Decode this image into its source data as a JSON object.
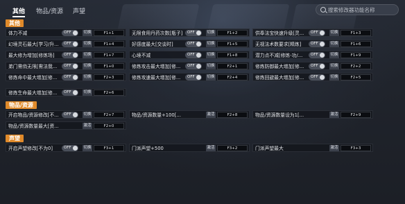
{
  "tabs": [
    {
      "label": "其他"
    },
    {
      "label": "物品/资源"
    },
    {
      "label": "声望"
    }
  ],
  "search": {
    "placeholder": "搜索修改器功能名称"
  },
  "sections": [
    {
      "title": "其他"
    },
    {
      "title": "物品/资源"
    },
    {
      "title": "声望"
    }
  ],
  "rows": [
    {
      "label": "体力不减",
      "toggle": "OFF",
      "action": "切换",
      "hotkey": "F1+1"
    },
    {
      "label": "无限食用丹药次数[瓶子]",
      "toggle": "OFF",
      "action": "切换",
      "hotkey": "F1+2"
    },
    {
      "label": "供奉法宝快速升级[灵...",
      "toggle": "OFF",
      "action": "切换",
      "hotkey": "F1+3"
    },
    {
      "label": "幻境灵石最大[学习/升...",
      "toggle": "OFF",
      "action": "切换",
      "hotkey": "F1+4"
    },
    {
      "label": "好感度最大[交谈时]",
      "toggle": "OFF",
      "action": "切换",
      "hotkey": "F1+5"
    },
    {
      "label": "无视法术数要求[精炼]",
      "toggle": "OFF",
      "action": "切换",
      "hotkey": "F1+6"
    },
    {
      "label": "最大修为增加[修炼场]",
      "toggle": "OFF",
      "action": "切换",
      "hotkey": "F1+7"
    },
    {
      "label": "心境不减",
      "toggle": "OFF",
      "action": "切换",
      "hotkey": "F1+8"
    },
    {
      "label": "潜力点不减[修炼-功/...",
      "toggle": "OFF",
      "action": "切换",
      "hotkey": "F1+9"
    },
    {
      "label": "弟门需俏无限[需法我...",
      "toggle": "OFF",
      "action": "切换",
      "hotkey": "F1+0"
    },
    {
      "label": "修炼攻击最大增加[修...",
      "toggle": "OFF",
      "action": "切换",
      "hotkey": "F2+1"
    },
    {
      "label": "修炼防御最大增加[修...",
      "toggle": "OFF",
      "action": "切换",
      "hotkey": "F2+2"
    },
    {
      "label": "修炼命中最大增加[修...",
      "toggle": "OFF",
      "action": "切换",
      "hotkey": "F2+3"
    },
    {
      "label": "修炼攻速最大增加[修...",
      "toggle": "OFF",
      "action": "切换",
      "hotkey": "F2+4"
    },
    {
      "label": "修炼回避最大增加[修...",
      "toggle": "OFF",
      "action": "切换",
      "hotkey": "F2+5"
    },
    {
      "label": "修炼生命最大增加[修...",
      "toggle": "OFF",
      "action": "切换",
      "hotkey": "F2+6"
    },
    {
      "label": "开启物品/资源修改[不...",
      "toggle": "OFF",
      "action": "切换",
      "hotkey": "F2+7"
    },
    {
      "label": "物品/资源数量+100[...",
      "toggle": "",
      "action": "激活",
      "hotkey": "F2+8"
    },
    {
      "label": "物品/资源数量设为1[...",
      "toggle": "",
      "action": "激活",
      "hotkey": "F2+9"
    },
    {
      "label": "物品/资源数量最大[资...",
      "toggle": "",
      "action": "激活",
      "hotkey": "F2+0"
    },
    {
      "label": "开启声望修改[不为0]",
      "toggle": "OFF",
      "action": "切换",
      "hotkey": "F3+1"
    },
    {
      "label": "门派声望+500",
      "toggle": "",
      "action": "激活",
      "hotkey": "F3+2"
    },
    {
      "label": "门派声望最大",
      "toggle": "",
      "action": "激活",
      "hotkey": "F3+3"
    }
  ]
}
